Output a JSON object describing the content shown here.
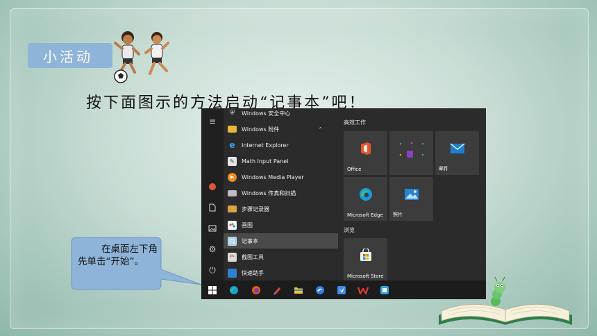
{
  "slide": {
    "dot": ".",
    "badge": "小活动",
    "instruction": "按下面图示的方法启动“记事本”吧！",
    "callout": "在桌面左下角先单击“开始”。"
  },
  "start_menu": {
    "apps": [
      {
        "label": "Windows 安全中心",
        "icon": "shield-icon"
      },
      {
        "label": "Windows 附件",
        "icon": "folder-icon",
        "expanded": true
      },
      {
        "label": "Internet Explorer",
        "icon": "internet-explorer-icon"
      },
      {
        "label": "Math Input Panel",
        "icon": "math-input-icon"
      },
      {
        "label": "Windows Media Player",
        "icon": "media-player-icon"
      },
      {
        "label": "Windows 传真和扫描",
        "icon": "fax-scan-icon"
      },
      {
        "label": "步骤记录器",
        "icon": "steps-recorder-icon"
      },
      {
        "label": "画图",
        "icon": "paint-icon"
      },
      {
        "label": "记事本",
        "icon": "notepad-icon",
        "selected": true
      },
      {
        "label": "截图工具",
        "icon": "snipping-tool-icon"
      },
      {
        "label": "快速助手",
        "icon": "quick-assist-icon"
      }
    ],
    "groups": {
      "productivity": "高效工作",
      "browse": "浏览"
    },
    "tiles": {
      "office": "Office",
      "mail": "邮件",
      "edge": "Microsoft Edge",
      "photos": "照片",
      "store": "Microsoft Store"
    },
    "rail_icons": [
      "menu-icon",
      "user-avatar-icon",
      "documents-icon",
      "pictures-icon",
      "settings-icon",
      "power-icon"
    ],
    "taskbar_icons": [
      "start-icon",
      "edge-icon",
      "firefox-icon",
      "pen-icon",
      "file-explorer-icon",
      "browser-icon",
      "feishu-icon",
      "wps-icon",
      "store-taskbar-icon"
    ]
  },
  "colors": {
    "badge": "#8fb4d9",
    "callout": "#8fb4d9",
    "start_menu_bg": "#2b2b2b",
    "taskbar_bg": "#1c1c1c",
    "tile_bg": "#3c3c3c"
  }
}
